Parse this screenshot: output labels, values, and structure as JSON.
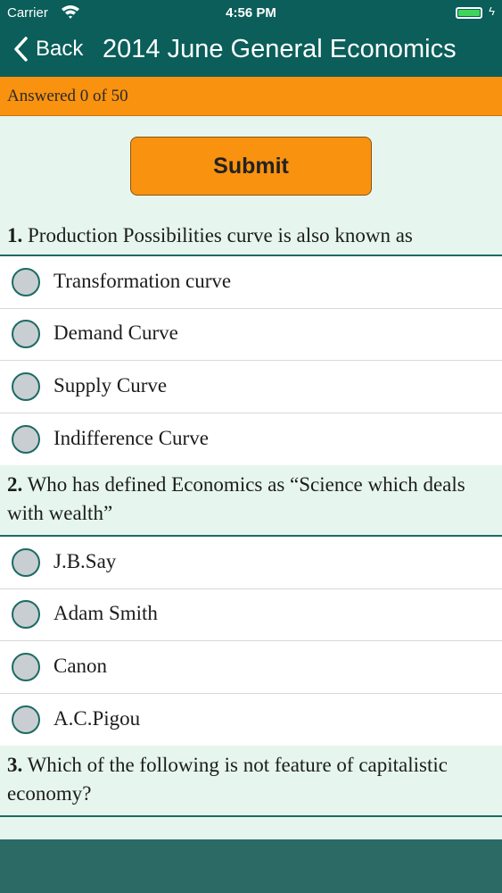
{
  "status": {
    "carrier": "Carrier",
    "time": "4:56 PM"
  },
  "nav": {
    "back_label": "Back",
    "title": "2014 June General Economics"
  },
  "progress": {
    "text": "Answered 0 of 50"
  },
  "submit": {
    "label": "Submit"
  },
  "questions": [
    {
      "number": "1.",
      "text": "Production Possibilities curve is also known as",
      "options": [
        "Transformation curve",
        "Demand Curve",
        "Supply Curve",
        "Indifference Curve"
      ]
    },
    {
      "number": "2.",
      "text": "Who has defined Economics as “Science which deals with wealth”",
      "options": [
        "J.B.Say",
        "Adam Smith",
        "Canon",
        "A.C.Pigou"
      ]
    },
    {
      "number": "3.",
      "text": "Which of the following is not feature of capitalistic economy?",
      "options": []
    }
  ],
  "colors": {
    "header": "#0b5e5a",
    "accent": "#f9920f",
    "background": "#e6f6ef",
    "radio_border": "#1b6b63"
  }
}
